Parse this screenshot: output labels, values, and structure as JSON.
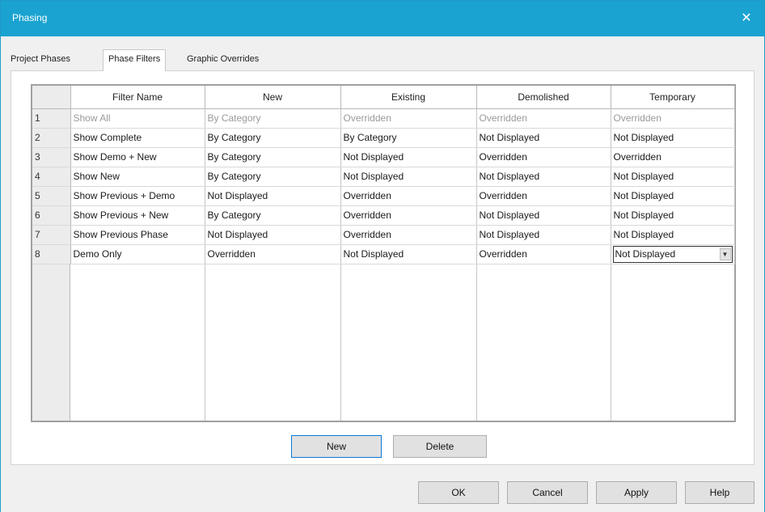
{
  "window": {
    "title": "Phasing",
    "close_glyph": "✕"
  },
  "tabs": [
    {
      "label": "Project Phases"
    },
    {
      "label": "Phase Filters"
    },
    {
      "label": "Graphic Overrides"
    }
  ],
  "grid": {
    "columns": [
      "",
      "Filter Name",
      "New",
      "Existing",
      "Demolished",
      "Temporary"
    ],
    "rows": [
      {
        "num": "1",
        "name": "Show All",
        "new": "By Category",
        "existing": "Overridden",
        "demolished": "Overridden",
        "temporary": "Overridden"
      },
      {
        "num": "2",
        "name": "Show Complete",
        "new": "By Category",
        "existing": "By Category",
        "demolished": "Not Displayed",
        "temporary": "Not Displayed"
      },
      {
        "num": "3",
        "name": "Show Demo + New",
        "new": "By Category",
        "existing": "Not Displayed",
        "demolished": "Overridden",
        "temporary": "Overridden"
      },
      {
        "num": "4",
        "name": "Show New",
        "new": "By Category",
        "existing": "Not Displayed",
        "demolished": "Not Displayed",
        "temporary": "Not Displayed"
      },
      {
        "num": "5",
        "name": "Show Previous + Demo",
        "new": "Not Displayed",
        "existing": "Overridden",
        "demolished": "Overridden",
        "temporary": "Not Displayed"
      },
      {
        "num": "6",
        "name": "Show Previous + New",
        "new": "By Category",
        "existing": "Overridden",
        "demolished": "Not Displayed",
        "temporary": "Not Displayed"
      },
      {
        "num": "7",
        "name": "Show Previous Phase",
        "new": "Not Displayed",
        "existing": "Overridden",
        "demolished": "Not Displayed",
        "temporary": "Not Displayed"
      },
      {
        "num": "8",
        "name": "Demo Only",
        "new": "Overridden",
        "existing": "Not Displayed",
        "demolished": "Overridden",
        "temporary": "Not Displayed"
      }
    ],
    "dropdown_arrow_icon": "chevron-down-icon"
  },
  "panel_buttons": {
    "new": "New",
    "delete": "Delete"
  },
  "footer_buttons": {
    "ok": "OK",
    "cancel": "Cancel",
    "apply": "Apply",
    "help": "Help"
  },
  "colors": {
    "titlebar": "#1aa3d1",
    "default_button_border": "#0a78d7"
  }
}
